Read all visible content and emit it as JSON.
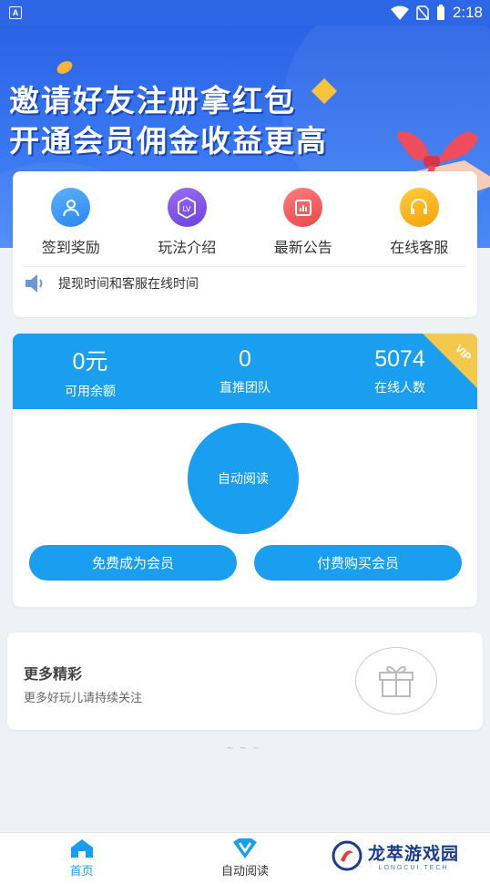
{
  "status_bar": {
    "badge": "A",
    "time": "2:18"
  },
  "banner": {
    "line1": "邀请好友注册拿红包",
    "line2": "开通会员佣金收益更高"
  },
  "menu": {
    "items": [
      {
        "label": "签到奖励"
      },
      {
        "label": "玩法介绍",
        "icon_text": "LV"
      },
      {
        "label": "最新公告"
      },
      {
        "label": "在线客服"
      }
    ],
    "notice": "提现时间和客服在线时间"
  },
  "stats": {
    "items": [
      {
        "value": "0元",
        "label": "可用余额"
      },
      {
        "value": "0",
        "label": "直推团队"
      },
      {
        "value": "5074",
        "label": "在线人数"
      }
    ],
    "vip_badge": "VIP",
    "auto_read": "自动阅读",
    "btn_free": "免费成为会员",
    "btn_paid": "付费购买会员"
  },
  "more": {
    "title": "更多精彩",
    "subtitle": "更多好玩儿请持续关注"
  },
  "divider_text": "~ ~ ~",
  "nav": {
    "home": "首页",
    "auto_read": "自动阅读"
  },
  "watermark": {
    "title": "龙萃游戏园",
    "subtitle": "LONGCUI.TECH"
  },
  "colors": {
    "primary": "#1a9ff0",
    "banner": "#2d67e6",
    "vip": "#f2c94c"
  }
}
